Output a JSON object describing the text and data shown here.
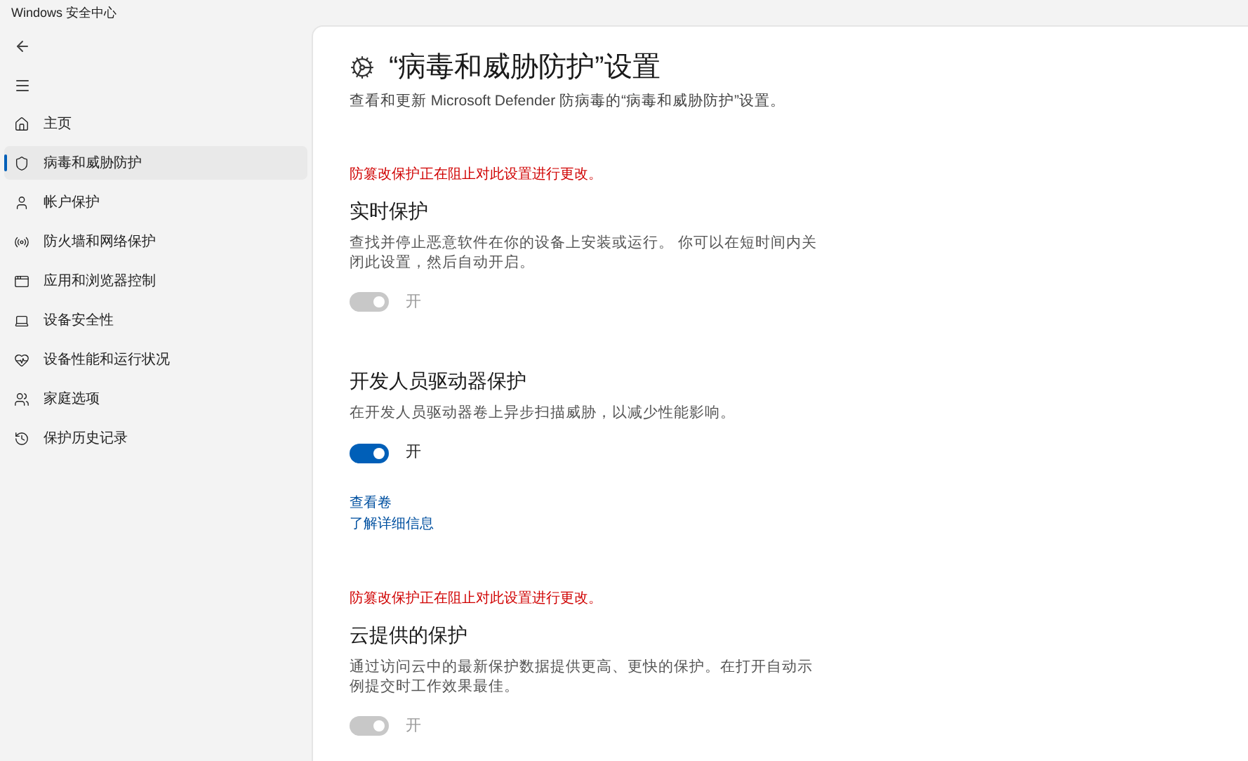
{
  "window": {
    "title": "Windows 安全中心"
  },
  "sidebar": {
    "items": [
      {
        "label": "主页",
        "selected": false
      },
      {
        "label": "病毒和威胁防护",
        "selected": true
      },
      {
        "label": "帐户保护",
        "selected": false
      },
      {
        "label": "防火墙和网络保护",
        "selected": false
      },
      {
        "label": "应用和浏览器控制",
        "selected": false
      },
      {
        "label": "设备安全性",
        "selected": false
      },
      {
        "label": "设备性能和运行状况",
        "selected": false
      },
      {
        "label": "家庭选项",
        "selected": false
      },
      {
        "label": "保护历史记录",
        "selected": false
      }
    ]
  },
  "page": {
    "title": "“病毒和威胁防护”设置",
    "subtitle": "查看和更新 Microsoft Defender 防病毒的“病毒和威胁防护”设置。"
  },
  "sections": [
    {
      "warning": "防篡改保护正在阻止对此设置进行更改。",
      "heading": "实时保护",
      "description": "查找并停止恶意软件在你的设备上安装或运行。 你可以在短时间内关闭此设置，然后自动开启。",
      "toggle": {
        "on": true,
        "disabled": true,
        "label": "开"
      }
    },
    {
      "heading": "开发人员驱动器保护",
      "description": "在开发人员驱动器卷上异步扫描威胁，以减少性能影响。",
      "toggle": {
        "on": true,
        "disabled": false,
        "label": "开"
      },
      "links": [
        "查看卷",
        "了解详细信息"
      ]
    },
    {
      "warning": "防篡改保护正在阻止对此设置进行更改。",
      "heading": "云提供的保护",
      "description": "通过访问云中的最新保护数据提供更高、更快的保护。在打开自动示例提交时工作效果最佳。",
      "toggle": {
        "on": true,
        "disabled": true,
        "label": "开"
      }
    }
  ]
}
